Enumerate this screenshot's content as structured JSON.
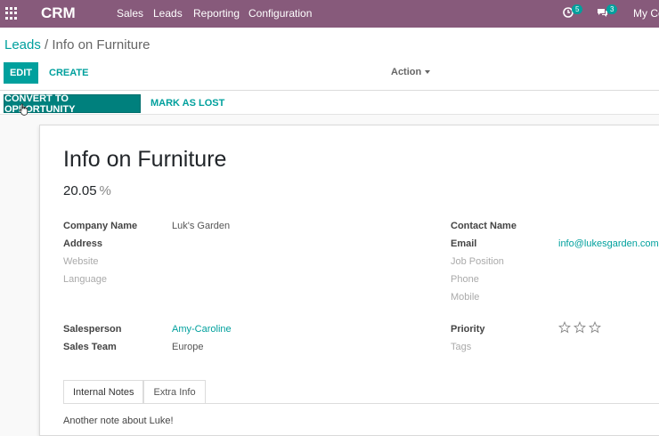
{
  "topbar": {
    "brand": "CRM",
    "menu": [
      "Sales",
      "Leads",
      "Reporting",
      "Configuration"
    ],
    "activity_count": "5",
    "messages_count": "3",
    "company": "My Co"
  },
  "control": {
    "breadcrumb_parent": "Leads",
    "breadcrumb_sep": "/",
    "breadcrumb_current": "Info on Furniture",
    "edit_label": "EDIT",
    "create_label": "CREATE",
    "action_label": "Action"
  },
  "statusbar": {
    "convert_label": "CONVERT TO OPPORTUNITY",
    "lost_label": "MARK AS LOST"
  },
  "lead": {
    "title": "Info on Furniture",
    "probability": "20.05",
    "probability_unit": "%",
    "left_fields": [
      {
        "label": "Company Name",
        "value": "Luk's Garden"
      },
      {
        "label": "Address",
        "value": ""
      },
      {
        "label": "Website",
        "value": ""
      },
      {
        "label": "Language",
        "value": ""
      }
    ],
    "right_fields": [
      {
        "label": "Contact Name",
        "value": ""
      },
      {
        "label": "Email",
        "value": "info@lukesgarden.com"
      },
      {
        "label": "Job Position",
        "value": ""
      },
      {
        "label": "Phone",
        "value": ""
      },
      {
        "label": "Mobile",
        "value": ""
      }
    ],
    "salesperson_label": "Salesperson",
    "salesperson": "Amy-Caroline",
    "team_label": "Sales Team",
    "team": "Europe",
    "priority_label": "Priority",
    "priority_stars": 0,
    "tags_label": "Tags",
    "tabs": [
      "Internal Notes",
      "Extra Info"
    ],
    "note": "Another note about Luke!"
  },
  "colors": {
    "brand": "#875a7b",
    "accent": "#00a09d"
  }
}
